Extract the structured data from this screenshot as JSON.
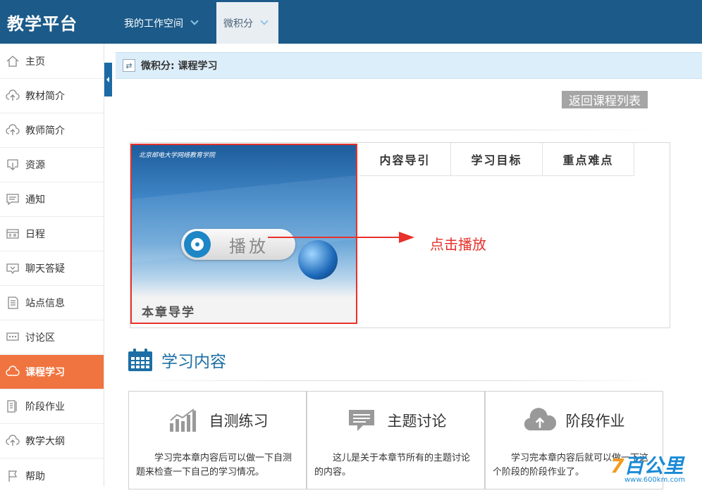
{
  "header": {
    "brand": "教学平台",
    "nav": [
      {
        "label": "我的工作空间"
      },
      {
        "label": "微积分"
      }
    ]
  },
  "sidebar": {
    "items": [
      {
        "label": "主页",
        "icon": "home-icon"
      },
      {
        "label": "教材简介",
        "icon": "cloud-upload-icon"
      },
      {
        "label": "教师简介",
        "icon": "cloud-upload-icon"
      },
      {
        "label": "资源",
        "icon": "download-box-icon"
      },
      {
        "label": "通知",
        "icon": "message-icon"
      },
      {
        "label": "日程",
        "icon": "calendar-icon"
      },
      {
        "label": "聊天答疑",
        "icon": "chat-icon"
      },
      {
        "label": "站点信息",
        "icon": "document-icon"
      },
      {
        "label": "讨论区",
        "icon": "discussion-icon"
      },
      {
        "label": "课程学习",
        "icon": "cloud-icon",
        "active": true
      },
      {
        "label": "阶段作业",
        "icon": "assignment-icon"
      },
      {
        "label": "教学大纲",
        "icon": "cloud-upload-icon"
      },
      {
        "label": "帮助",
        "icon": "flag-icon"
      }
    ]
  },
  "breadcrumb": {
    "text": "微积分: 课程学习"
  },
  "actions": {
    "back_label": "返回课程列表"
  },
  "video": {
    "play_label": "播放",
    "chapter_title": "本章导学",
    "logo_text": "北京邮电大学网络教育学院"
  },
  "tabs": [
    {
      "label": "内容导引"
    },
    {
      "label": "学习目标"
    },
    {
      "label": "重点难点"
    }
  ],
  "annotation": {
    "label": "点击播放",
    "color": "#e8312b"
  },
  "section": {
    "title": "学习内容"
  },
  "cards": [
    {
      "title": "自测练习",
      "desc": "学习完本章内容后可以做一下自测题来检查一下自己的学习情况。",
      "icon": "chart-icon"
    },
    {
      "title": "主题讨论",
      "desc": "这儿是关于本章节所有的主题讨论的内容。",
      "icon": "speech-bubble-icon"
    },
    {
      "title": "阶段作业",
      "desc": "学习完本章内容后就可以做一下这个阶段的阶段作业了。",
      "icon": "cloud-upload-icon"
    }
  ],
  "watermark": {
    "brand_prefix": "7",
    "brand_rest": "百公里",
    "url": "www.600km.com"
  },
  "colors": {
    "header": "#1b5a89",
    "active_sidebar": "#f0743f",
    "accent_blue": "#1c6ea4"
  }
}
